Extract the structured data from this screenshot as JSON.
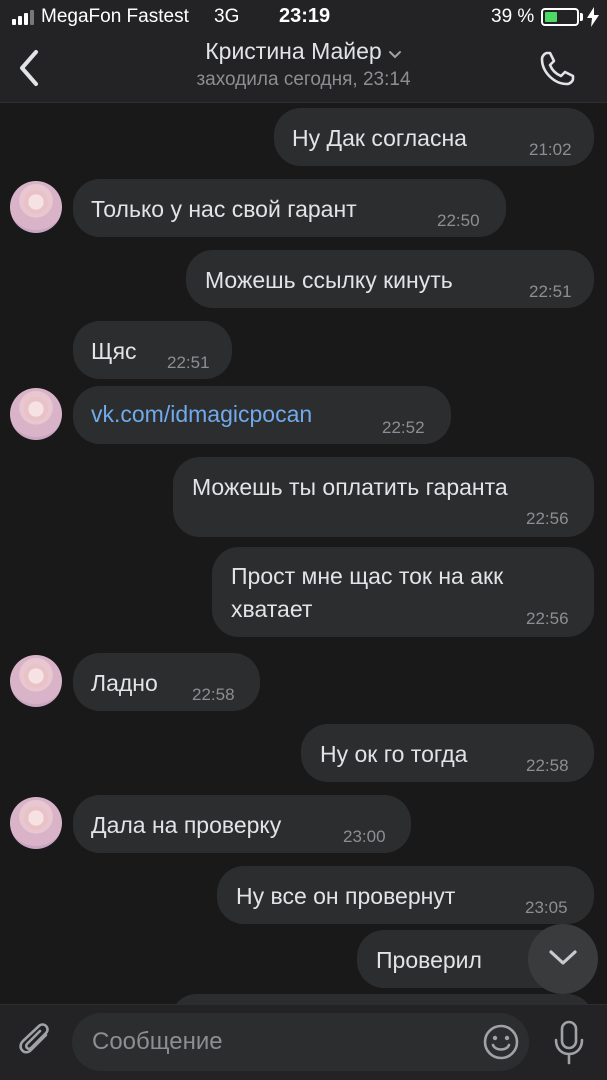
{
  "status_bar": {
    "carrier": "MegaFon Fastest",
    "network": "3G",
    "time": "23:19",
    "battery_percent": "39 %",
    "battery_level": 0.39,
    "battery_color": "#4cd964"
  },
  "header": {
    "contact_name": "Кристина Майер",
    "last_seen": "заходила сегодня, 23:14",
    "back_icon": "chevron-left-icon",
    "call_icon": "phone-icon"
  },
  "messages": [
    {
      "direction": "out",
      "text": "Ну Дак согласна",
      "time": "21:02"
    },
    {
      "direction": "in",
      "text": "Только у нас свой гарант",
      "time": "22:50",
      "avatar": true
    },
    {
      "direction": "out",
      "text": "Можешь ссылку кинуть",
      "time": "22:51"
    },
    {
      "direction": "in",
      "text": "Щяс",
      "time": "22:51",
      "avatar": false
    },
    {
      "direction": "in",
      "text": "vk.com/idmagicpocan",
      "time": "22:52",
      "avatar": true,
      "link": true
    },
    {
      "direction": "out",
      "text": "Можешь ты оплатить гаранта",
      "time": "22:56"
    },
    {
      "direction": "out",
      "text_lines": [
        "Прост мне щас ток на акк",
        "хватает"
      ],
      "time": "22:56"
    },
    {
      "direction": "in",
      "text": "Ладно",
      "time": "22:58",
      "avatar": true
    },
    {
      "direction": "out",
      "text": "Ну ок го тогда",
      "time": "22:58"
    },
    {
      "direction": "in",
      "text": "Дала на проверку",
      "time": "23:00",
      "avatar": true
    },
    {
      "direction": "out",
      "text": "Ну все он провернут",
      "time": "23:05"
    },
    {
      "direction": "out",
      "text": "Проверил",
      "time": ""
    }
  ],
  "composer": {
    "placeholder": "Сообщение",
    "attach_icon": "paperclip-icon",
    "emoji_icon": "smile-icon",
    "mic_icon": "microphone-icon"
  },
  "colors": {
    "background": "#19191a",
    "bubble": "#2c2d2e",
    "bar": "#232325",
    "link": "#71aaeb",
    "secondary_text": "#8c8e91"
  }
}
